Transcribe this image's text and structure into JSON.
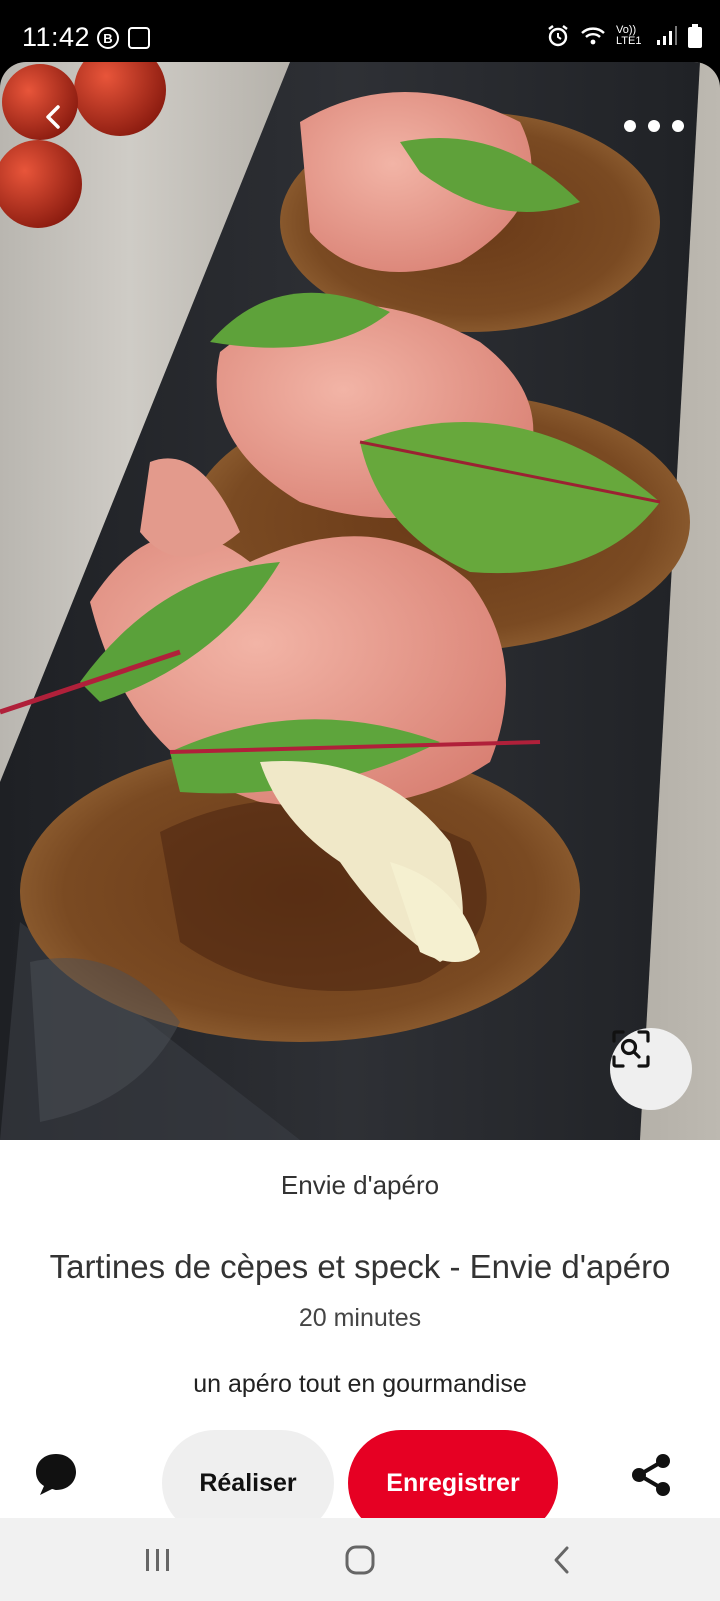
{
  "status_bar": {
    "time": "11:42",
    "badge_b": "B",
    "network_label": "Vo)) LTE1",
    "icons": [
      "alarm-icon",
      "wifi-icon",
      "signal-icon",
      "battery-icon"
    ]
  },
  "pin": {
    "source": "Envie d'apéro",
    "title": "Tartines de cèpes et speck - Envie d'apéro",
    "duration": "20 minutes",
    "description": "un apéro tout en gourmandise"
  },
  "actions": {
    "make_label": "Réaliser",
    "save_label": "Enregistrer"
  },
  "colors": {
    "accent": "#e60023",
    "secondary_button": "#efefef"
  }
}
